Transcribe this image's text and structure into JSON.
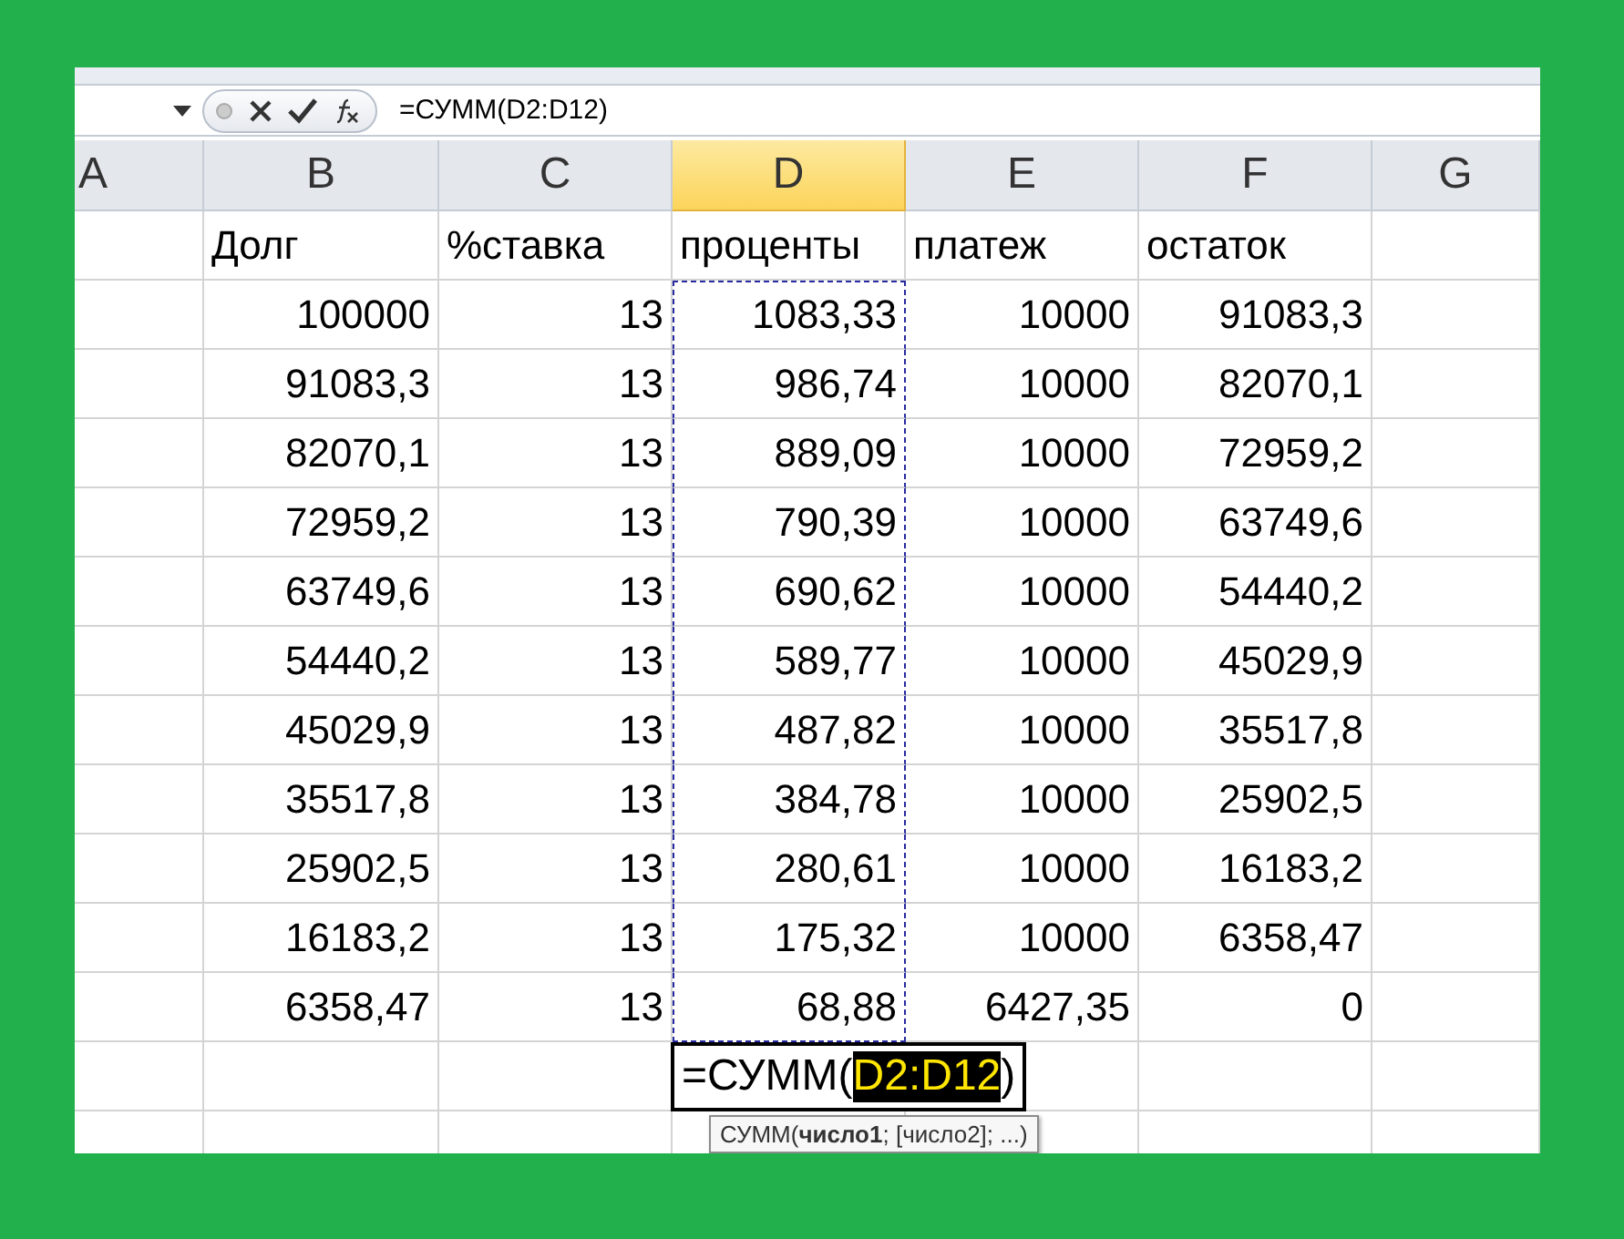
{
  "formula_bar": {
    "formula": "=СУММ(D2:D12)"
  },
  "columns": [
    {
      "label": "A",
      "selected": false
    },
    {
      "label": "B",
      "selected": false
    },
    {
      "label": "C",
      "selected": false
    },
    {
      "label": "D",
      "selected": true
    },
    {
      "label": "E",
      "selected": false
    },
    {
      "label": "F",
      "selected": false
    },
    {
      "label": "G",
      "selected": false
    }
  ],
  "header_row": [
    "Долг",
    "%ставка",
    "проценты",
    "платеж",
    "остаток"
  ],
  "rows": [
    [
      "100000",
      "13",
      "1083,33",
      "10000",
      "91083,3"
    ],
    [
      "91083,3",
      "13",
      "986,74",
      "10000",
      "82070,1"
    ],
    [
      "82070,1",
      "13",
      "889,09",
      "10000",
      "72959,2"
    ],
    [
      "72959,2",
      "13",
      "790,39",
      "10000",
      "63749,6"
    ],
    [
      "63749,6",
      "13",
      "690,62",
      "10000",
      "54440,2"
    ],
    [
      "54440,2",
      "13",
      "589,77",
      "10000",
      "45029,9"
    ],
    [
      "45029,9",
      "13",
      "487,82",
      "10000",
      "35517,8"
    ],
    [
      "35517,8",
      "13",
      "384,78",
      "10000",
      "25902,5"
    ],
    [
      "25902,5",
      "13",
      "280,61",
      "10000",
      "16183,2"
    ],
    [
      "16183,2",
      "13",
      "175,32",
      "10000",
      "6358,47"
    ],
    [
      "6358,47",
      "13",
      "68,88",
      "6427,35",
      "0"
    ]
  ],
  "editing_cell": {
    "prefix": "=СУММ(",
    "reference": "D2:D12",
    "suffix": ")"
  },
  "tooltip": {
    "text": "СУММ(**число1**; [число2]; ...)"
  }
}
